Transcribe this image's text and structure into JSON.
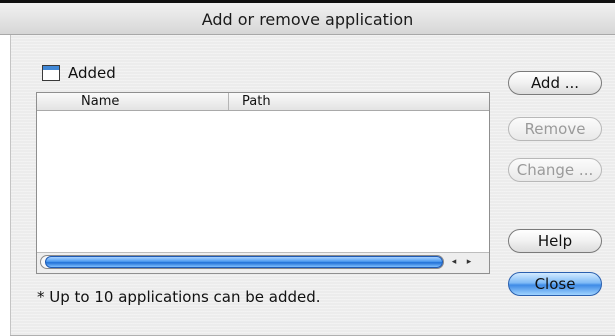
{
  "window": {
    "title": "Add or remove application"
  },
  "section": {
    "label": "Added"
  },
  "table": {
    "columns": [
      "Name",
      "Path"
    ],
    "rows": []
  },
  "scrollbar": {
    "left_arrow": "◂",
    "right_arrow": "▸"
  },
  "footnote": "* Up to 10 applications can be added.",
  "buttons": {
    "add": "Add ...",
    "remove": "Remove",
    "change": "Change ...",
    "help": "Help",
    "close": "Close"
  }
}
